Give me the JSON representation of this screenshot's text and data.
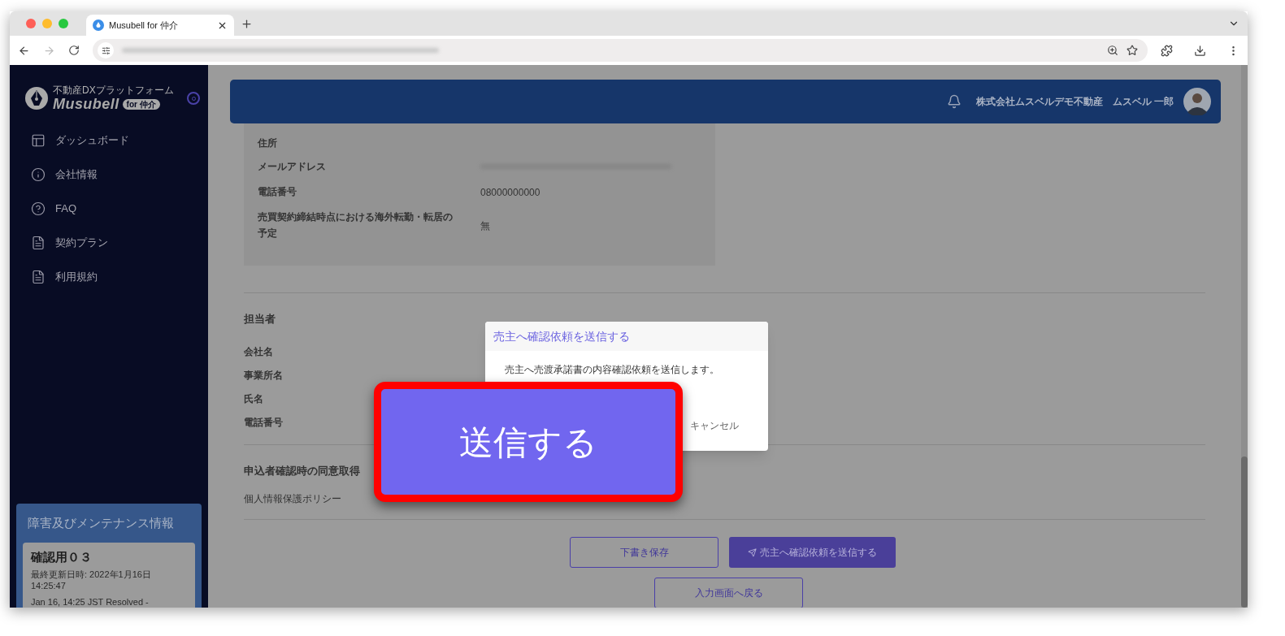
{
  "browser": {
    "tab": {
      "title": "Musubell for 仲介"
    },
    "forward_disabled": true
  },
  "sidebar": {
    "logo": {
      "tagline": "不動産DXプラットフォーム",
      "name": "Musubell",
      "badge": "for 仲介"
    },
    "items": [
      {
        "label": "ダッシュボード",
        "kind": "layout"
      },
      {
        "label": "会社情報",
        "kind": "info"
      },
      {
        "label": "FAQ",
        "kind": "help"
      },
      {
        "label": "契約プラン",
        "kind": "document"
      },
      {
        "label": "利用規約",
        "kind": "document"
      }
    ],
    "maintenance": {
      "title": "障害及びメンテナンス情報",
      "entry_title": "確認用０３",
      "updated": "最終更新日時: 2022年1月16日 14:25:47",
      "note": "Jan 16, 14:25 JST Resolved -"
    }
  },
  "header": {
    "company": "株式会社ムスベルデモ不動産",
    "user": "ムスベル 一郎"
  },
  "seller_fields": [
    {
      "label": "住所"
    },
    {
      "label": "メールアドレス",
      "redacted": true
    },
    {
      "label": "電話番号",
      "value": "08000000000"
    },
    {
      "label": "売買契約締結時点における海外転勤・転居の予定",
      "value": "無"
    }
  ],
  "staff": {
    "title": "担当者",
    "fields": [
      "会社名",
      "事業所名",
      "氏名",
      "電話番号"
    ]
  },
  "consent": {
    "title": "申込者確認時の同意取得",
    "items": [
      "個人情報保護ポリシー"
    ]
  },
  "actions": {
    "save_draft": "下書き保存",
    "send": "売主へ確認依頼を送信する",
    "back": "入力画面へ戻る"
  },
  "dialog": {
    "title": "売主へ確認依頼を送信する",
    "message": "売主へ売渡承諾書の内容確認依頼を送信します。",
    "cancel": "キャンセル"
  },
  "callout": {
    "label": "送信する"
  }
}
